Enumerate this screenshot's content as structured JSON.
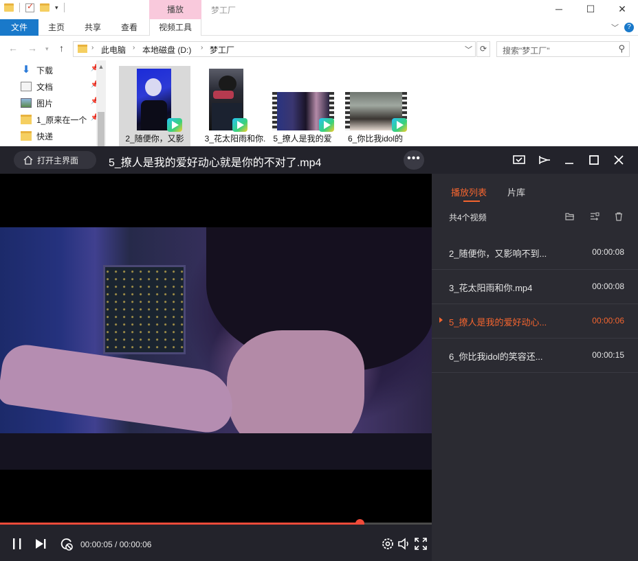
{
  "explorer": {
    "play_context_tab": "播放",
    "window_title": "梦工厂",
    "ribbon_tabs": [
      "文件",
      "主页",
      "共享",
      "查看",
      "视频工具"
    ],
    "breadcrumb": [
      "此电脑",
      "本地磁盘 (D:)",
      "梦工厂"
    ],
    "search_placeholder": "搜索\"梦工厂\"",
    "nav_items": [
      {
        "label": "下载",
        "icon": "download-icon",
        "pinned": true
      },
      {
        "label": "文档",
        "icon": "document-icon",
        "pinned": true
      },
      {
        "label": "图片",
        "icon": "picture-icon",
        "pinned": true
      },
      {
        "label": "1_原来在一个",
        "icon": "folder-icon",
        "pinned": true
      },
      {
        "label": "快递",
        "icon": "folder-icon",
        "pinned": false
      }
    ],
    "files": [
      {
        "name": "2_随便你，又影",
        "selected": true
      },
      {
        "name": "3_花太阳雨和你.",
        "selected": false
      },
      {
        "name": "5_撩人是我的爱",
        "selected": false
      },
      {
        "name": "6_你比我idol的",
        "selected": false
      }
    ]
  },
  "player": {
    "home_button": "打开主界面",
    "title": "5_撩人是我的爱好动心就是你的不对了.mp4",
    "more_label": "•••",
    "current_time": "00:00:05",
    "duration": "00:00:06",
    "time_display": "00:00:05 / 00:00:06",
    "progress": 0.833,
    "accent_color": "#f5652f",
    "progress_color": "#f04b3a"
  },
  "sidepanel": {
    "tabs": [
      "播放列表",
      "片库"
    ],
    "active_tab": "播放列表",
    "count_label": "共4个视频",
    "playlist": [
      {
        "name": "2_随便你，又影响不到...",
        "duration": "00:00:08",
        "playing": false
      },
      {
        "name": "3_花太阳雨和你.mp4",
        "duration": "00:00:08",
        "playing": false
      },
      {
        "name": "5_撩人是我的爱好动心...",
        "duration": "00:00:06",
        "playing": true
      },
      {
        "name": "6_你比我idol的笑容还...",
        "duration": "00:00:15",
        "playing": false
      }
    ]
  }
}
